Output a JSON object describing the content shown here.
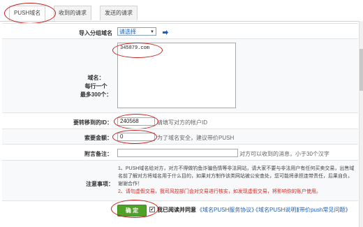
{
  "tabs": [
    {
      "label": "PUSH域名",
      "active": true
    },
    {
      "label": "收到的请求",
      "active": false
    },
    {
      "label": "发送的请求",
      "active": false
    }
  ],
  "form": {
    "import_label": "导入分组域名",
    "import_select": "请选择",
    "domain_label_lines": [
      "域名：",
      "每行一个",
      "最多300个："
    ],
    "domain_value": "345879.com",
    "target_id_label": "要转移到的ID：",
    "target_id_value": "240568",
    "target_id_hint": "请填写对方的帐户ID",
    "price_label": "索要金额：",
    "price_value": "0",
    "price_hint": "为了域名安全，建议带价PUSH",
    "remark_label": "附言备注：",
    "remark_value": "",
    "remark_hint": "对方可以收到的消息，小于30个汉字",
    "notice_label": "注意事项：",
    "notice_1": "1、PUSH域名给对方，对方不得做钓鱼诈骗色情等非法网站，请大家不要与非法用户有任何买卖交易，出售域名前了解对方将域名用于什么目的，如果对方制作该类网站被公安查处，您可能将承担连带责任，后果自负，谢谢合作！",
    "notice_2": "2、请勿虚假交易，我司风控部门会对交易进行核实，如发现虚假交易，将影响你的账户使用。",
    "confirm_button": "确 定",
    "agree_text": "我已阅读并同意",
    "links": [
      "《域名PUSH服务协议》",
      "《域名PUSH说明》",
      "《带价push常见问题》"
    ]
  },
  "colors": {
    "accent_green": "#4fa127",
    "link_blue": "#1f5fb8",
    "annotation_red": "#c8201e",
    "warning_red": "#d7261f"
  }
}
